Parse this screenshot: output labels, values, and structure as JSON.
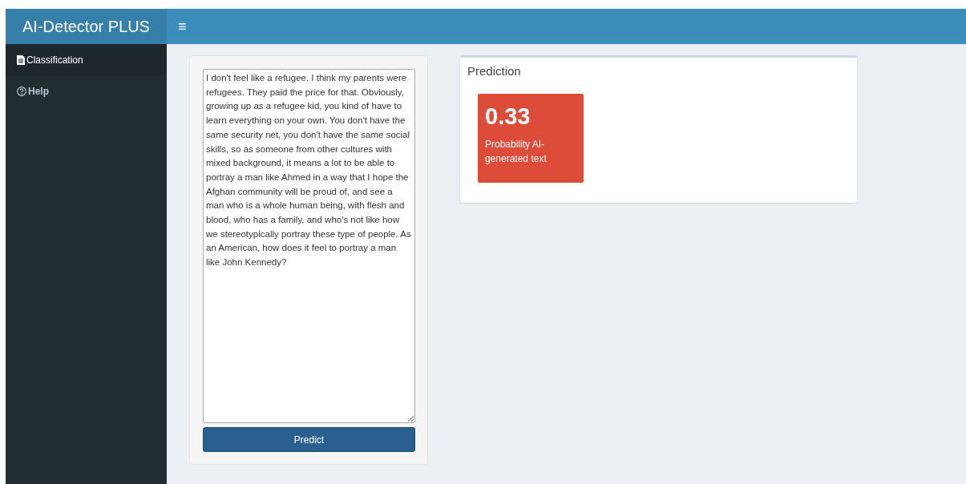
{
  "header": {
    "title": "AI-Detector PLUS",
    "menu_toggle": "≡"
  },
  "sidebar": {
    "items": [
      {
        "label": "Classification",
        "selected": true
      },
      {
        "label": "Help",
        "selected": false
      }
    ]
  },
  "input": {
    "value": "I don't feel like a refugee. I think my parents were refugees. They paid the price for that. Obviously, growing up as a refugee kid, you kind of have to learn everything on your own. You don't have the same security net, you don't have the same social skills, so as someone from other cultures with mixed background, it means a lot to be able to portray a man like Ahmed in a way that I hope the Afghan community will be proud of, and see a man who is a whole human being, with flesh and blood, who has a family, and who's not like how we stereotypically portray these type of people. As an American, how does it feel to portray a man like John Kennedy?",
    "button": "Predict"
  },
  "prediction": {
    "title": "Prediction",
    "value": "0.33",
    "caption": "Probability AI-generated text",
    "color": "#dd4b39"
  }
}
